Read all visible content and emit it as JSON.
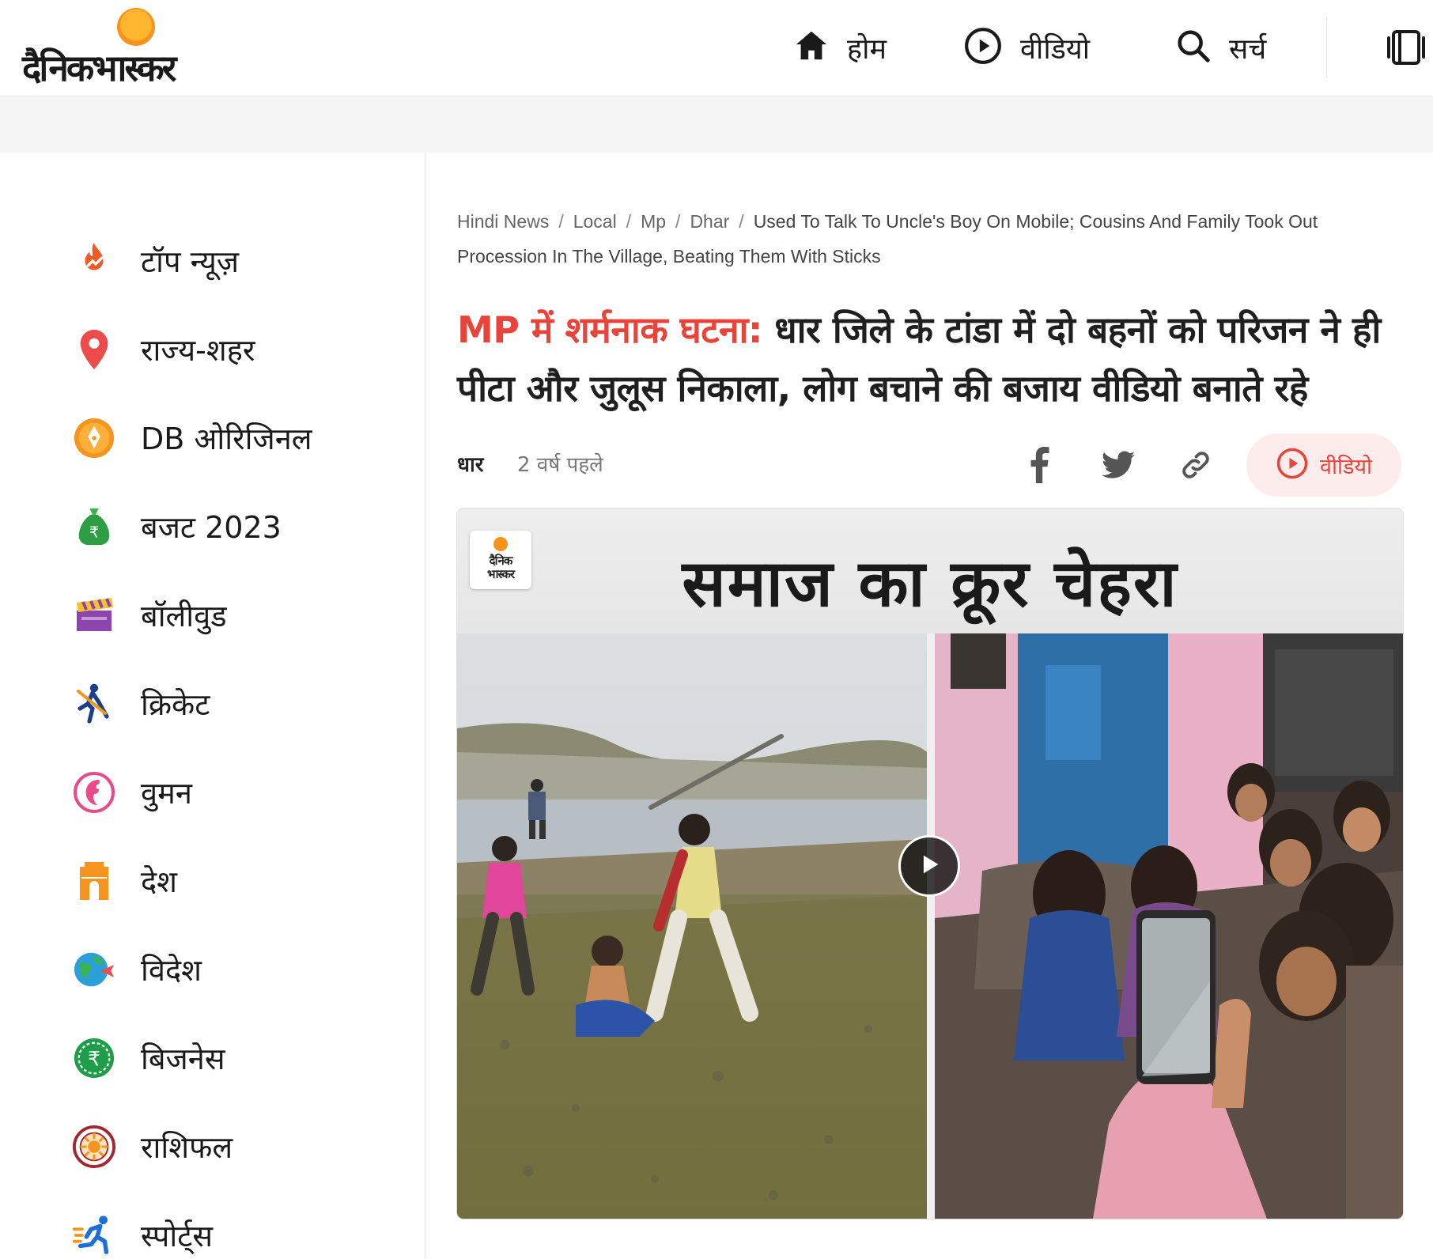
{
  "brand": {
    "logo_text": "दैनिकभास्कर"
  },
  "nav": {
    "home": "होम",
    "video": "वीडियो",
    "search": "सर्च"
  },
  "sidebar": {
    "items": [
      {
        "label": "टॉप न्यूज़",
        "icon": "fire-icon"
      },
      {
        "label": "राज्य-शहर",
        "icon": "location-pin-icon"
      },
      {
        "label": "DB ओरिजिनल",
        "icon": "pen-nib-icon"
      },
      {
        "label": "बजट 2023",
        "icon": "money-bag-icon"
      },
      {
        "label": "बॉलीवुड",
        "icon": "clapperboard-icon"
      },
      {
        "label": "क्रिकेट",
        "icon": "cricket-batsman-icon"
      },
      {
        "label": "वुमन",
        "icon": "woman-face-icon"
      },
      {
        "label": "देश",
        "icon": "india-gate-icon"
      },
      {
        "label": "विदेश",
        "icon": "globe-plane-icon"
      },
      {
        "label": "बिजनेस",
        "icon": "rupee-coin-icon"
      },
      {
        "label": "राशिफल",
        "icon": "zodiac-wheel-icon"
      },
      {
        "label": "स्पोर्ट्स",
        "icon": "runner-icon"
      }
    ]
  },
  "breadcrumb": {
    "items": [
      "Hindi News",
      "Local",
      "Mp",
      "Dhar"
    ],
    "current": "Used To Talk To Uncle's Boy On Mobile; Cousins And Family Took Out Procession In The Village, Beating Them With Sticks"
  },
  "article": {
    "kicker": "MP में शर्मनाक घटना:",
    "headline": " धार जिले के टांडा में दो बहनों को परिजन ने ही पीटा और जुलूस निकाला, लोग बचाने की बजाय वीडियो बनाते रहे",
    "location": "धार",
    "time_ago": "2 वर्ष पहले",
    "video_label": "वीडियो"
  },
  "media": {
    "title": "समाज का क्रूर चेहरा",
    "watermark": "दैनिक भास्कर"
  },
  "colors": {
    "accent": "#e8443a",
    "logo_sun": "#f7941d",
    "pill_bg": "#fdecec"
  }
}
